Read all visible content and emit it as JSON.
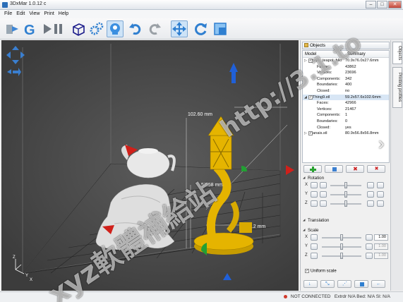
{
  "window": {
    "title": "3DxMar 1.0.12 c"
  },
  "menu": [
    "File",
    "Edit",
    "View",
    "Print",
    "Help"
  ],
  "toolbar": {
    "icons": [
      "load-icon",
      "gcode-icon",
      "run-pause-icon",
      "view-box-icon",
      "gear-icon",
      "head-icon",
      "undo-icon",
      "redo-icon",
      "move-icon",
      "rotate-icon",
      "scale-icon"
    ]
  },
  "viewport": {
    "dim_height": "102.60 mm",
    "dim_depth": "57.58 mm",
    "dim_width": "59.2 mm"
  },
  "objects": {
    "header": "Objects",
    "col_model": "Model",
    "col_summary": "Summary",
    "rows": [
      {
        "key": "utah_teapot_hllo",
        "value": "70.9x76.0x27.6mm",
        "level": "top"
      },
      {
        "key": "Faces:",
        "value": "43862"
      },
      {
        "key": "Vertices:",
        "value": "23696"
      },
      {
        "key": "Components:",
        "value": "342"
      },
      {
        "key": "Boundaries:",
        "value": "400"
      },
      {
        "key": "Closed:",
        "value": "no"
      },
      {
        "key": "Thing9.stl",
        "value": "59.2x57.6x102.6mm",
        "level": "top",
        "selected": true
      },
      {
        "key": "Faces:",
        "value": "42966"
      },
      {
        "key": "Vertices:",
        "value": "21467"
      },
      {
        "key": "Components:",
        "value": "1"
      },
      {
        "key": "Boundaries:",
        "value": "0"
      },
      {
        "key": "Closed:",
        "value": "yes"
      },
      {
        "key": "anais.stl",
        "value": "80.9x56.8x56.8mm",
        "level": "top"
      }
    ]
  },
  "rotation": {
    "title": "Rotation",
    "axes": [
      "X",
      "Y",
      "Z"
    ]
  },
  "translation": {
    "title": "Translation"
  },
  "scale": {
    "title": "Scale",
    "axes": [
      {
        "label": "X",
        "value": "1.00"
      },
      {
        "label": "Y",
        "value": "1.00"
      },
      {
        "label": "Z",
        "value": "1.00"
      }
    ],
    "uniform_label": "Uniform scale"
  },
  "side_tabs": {
    "objects": "Objects",
    "printing": "Printing profiles"
  },
  "status": {
    "text": "NOT CONNECTED",
    "extruder": "Extrdr N/A Bed: N/A  Sl: N/A"
  },
  "watermark": {
    "url": "http://3.1.to",
    "cjk": "xyz軟體補給站"
  },
  "colors": {
    "object_gold": "#e5b400",
    "teapot_white": "#e8e8e8",
    "viewport": "#474747",
    "axis_red": "#d0201a",
    "axis_blue": "#2060d8",
    "axis_green": "#22a033"
  }
}
